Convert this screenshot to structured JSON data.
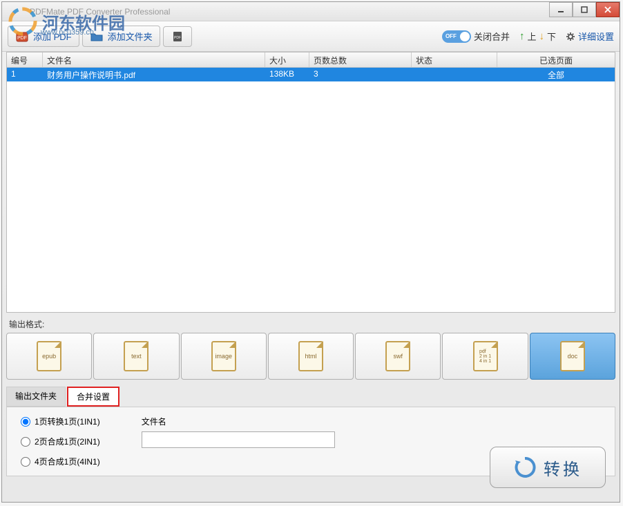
{
  "window": {
    "title": "PDFMate PDF Converter Professional"
  },
  "watermark": {
    "text": "河东软件园",
    "sub": "www.pc0359.cn"
  },
  "toolbar": {
    "add_pdf": "添加 PDF",
    "add_folder": "添加文件夹",
    "toggle_label": "OFF",
    "close_merge": "关闭合并",
    "up": "上",
    "down": "下",
    "settings": "详细设置"
  },
  "table": {
    "headers": {
      "num": "编号",
      "name": "文件名",
      "size": "大小",
      "pages": "页数总数",
      "status": "状态",
      "selected": "已选页面"
    },
    "rows": [
      {
        "num": "1",
        "name": "财务用户操作说明书.pdf",
        "size": "138KB",
        "pages": "3",
        "status": "",
        "selected": "全部"
      }
    ]
  },
  "output": {
    "format_label": "输出格式:",
    "formats": [
      "epub",
      "text",
      "image",
      "html",
      "swf",
      "pdf\n2 in 1\n4 in 1",
      "doc"
    ]
  },
  "tabs": {
    "output_folder": "输出文件夹",
    "merge_settings": "合并设置"
  },
  "merge": {
    "option1": "1页转换1页(1IN1)",
    "option2": "2页合成1页(2IN1)",
    "option3": "4页合成1页(4IN1)",
    "filename_label": "文件名",
    "filename_value": ""
  },
  "convert": {
    "label": "转换"
  }
}
